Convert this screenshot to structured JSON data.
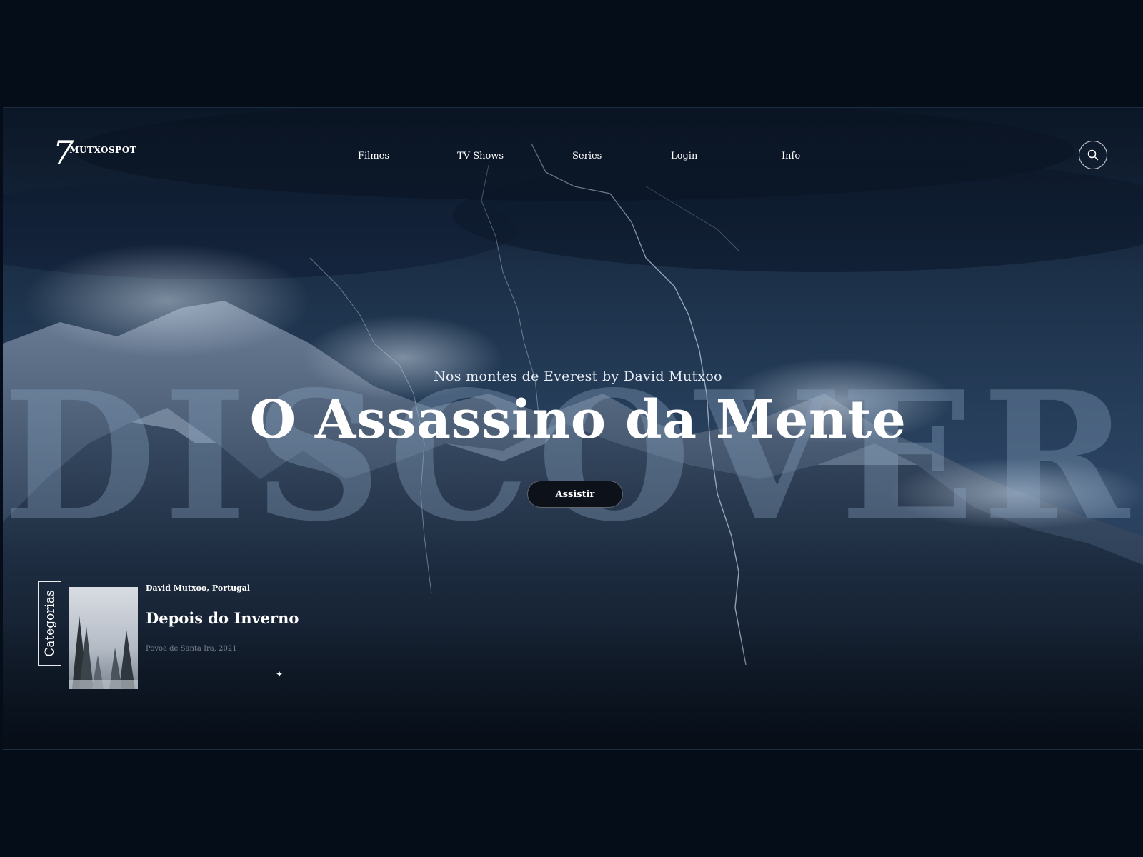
{
  "brand": {
    "mark": "7",
    "name": "MUTXOSPOT"
  },
  "nav": {
    "items": [
      {
        "label": "Filmes"
      },
      {
        "label": "TV Shows"
      },
      {
        "label": "Series"
      },
      {
        "label": "Login"
      },
      {
        "label": "Info"
      }
    ]
  },
  "icons": {
    "search": "search-icon",
    "sparkle": "sparkle-icon"
  },
  "hero": {
    "watermark": "DISCOVER",
    "subtitle": "Nos montes de Everest by David Mutxoo",
    "title": "O Assassino da Mente",
    "cta_label": "Assistir"
  },
  "categories": {
    "tab_label": "Categorias",
    "card": {
      "meta": "David Mutxoo, Portugal",
      "title": "Depois do Inverno",
      "caption": "Povoa de Santa Ira, 2021"
    }
  },
  "colors": {
    "page_bg": "#050d18",
    "sky_dark": "#0e1b2c",
    "mountain_dark": "#0b1420",
    "button_bg": "#0c111a",
    "text": "#ffffff"
  }
}
